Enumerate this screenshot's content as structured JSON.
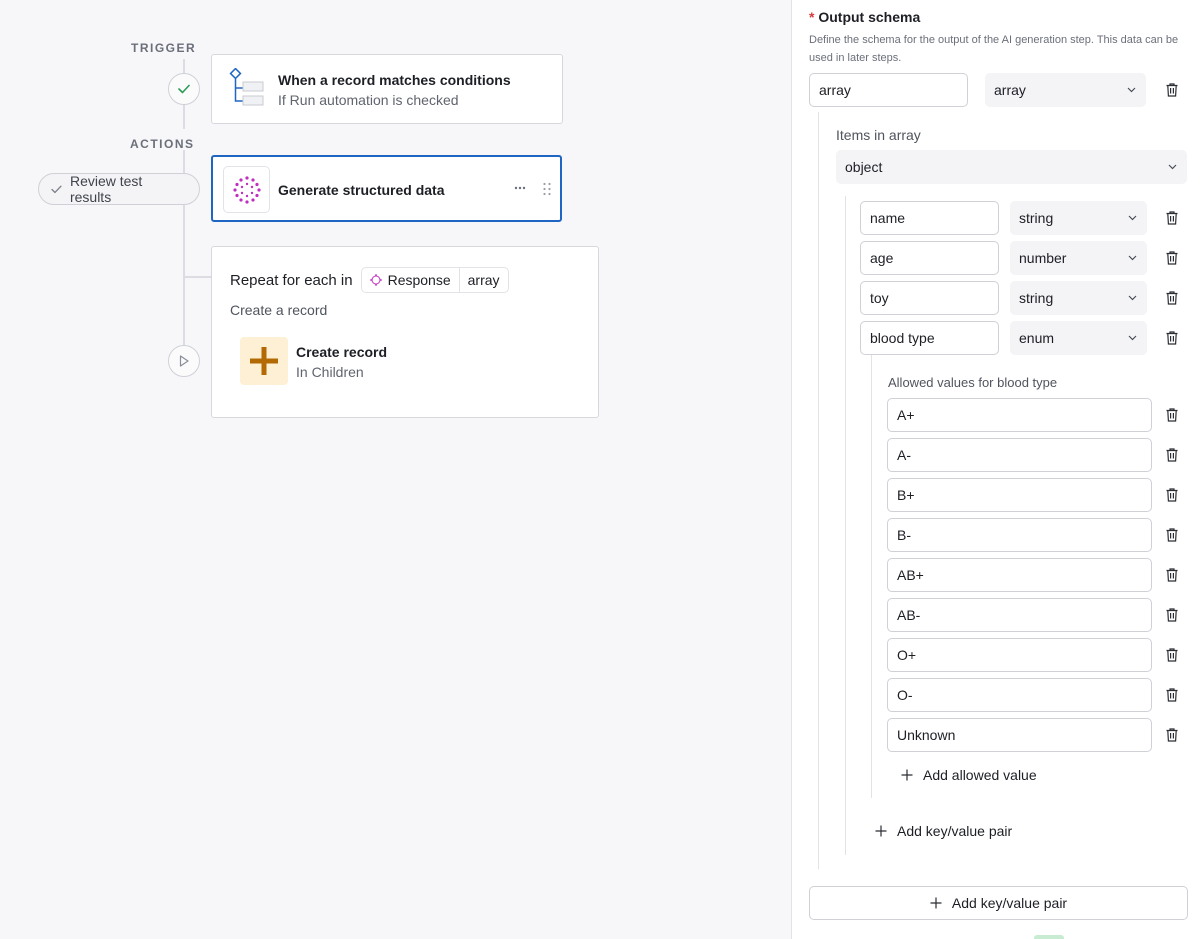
{
  "canvas": {
    "trigger_label": "TRIGGER",
    "actions_label": "ACTIONS",
    "trigger_card": {
      "title": "When a record matches conditions",
      "subtitle": "If Run automation is checked"
    },
    "review_pill": {
      "label": "Review test results"
    },
    "ai_card": {
      "title": "Generate structured data",
      "more_icon": "ellipsis-icon",
      "drag_icon": "drag-handle-icon"
    },
    "repeat_card": {
      "title": "Repeat for each in",
      "chip_source": "Response",
      "chip_type": "array",
      "subtitle": "Create a record",
      "inner": {
        "title": "Create record",
        "subtitle": "In Children"
      }
    }
  },
  "panel": {
    "required_mark": "*",
    "title": "Output schema",
    "description": "Define the schema for the output of the AI generation step. This data can be used in later steps.",
    "root": {
      "name": "array",
      "type": "array"
    },
    "items_label": "Items in array",
    "items_type": "object",
    "fields": [
      {
        "name": "name",
        "type": "string"
      },
      {
        "name": "age",
        "type": "number"
      },
      {
        "name": "toy",
        "type": "string"
      },
      {
        "name": "blood type",
        "type": "enum"
      }
    ],
    "allowed_values_label": "Allowed values for blood type",
    "allowed_values": [
      "A+",
      "A-",
      "B+",
      "B-",
      "AB+",
      "AB-",
      "O+",
      "O-",
      "Unknown"
    ],
    "add_allowed_value": "Add allowed value",
    "add_kv_inner": "Add key/value pair",
    "add_kv_outer": "Add key/value pair"
  },
  "colors": {
    "accent_blue": "#1f66c4",
    "ai_magenta": "#c02fbf",
    "create_record_orange": "#b46a04",
    "create_record_bg": "#fdf0d4",
    "check_green": "#2d9c5a"
  }
}
